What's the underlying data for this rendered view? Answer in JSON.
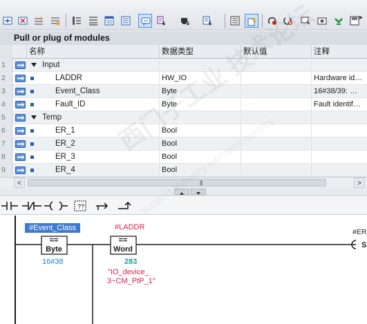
{
  "toolbar": {
    "buttons": [
      {
        "name": "insert-network-icon"
      },
      {
        "name": "delete-network-icon"
      },
      {
        "name": "insert-row-icon"
      },
      {
        "name": "append-row-icon"
      },
      {
        "name": "list-icon"
      },
      {
        "name": "block-view-icon"
      },
      {
        "name": "window-icon"
      },
      {
        "name": "comment-icon"
      },
      {
        "name": "open-branch-icon"
      },
      {
        "name": "monitor-icon"
      },
      {
        "name": "download-icon"
      },
      {
        "name": "absolute-icon"
      },
      {
        "name": "favorites-icon"
      },
      {
        "name": "goto-error-icon"
      },
      {
        "name": "goto-warning-icon"
      },
      {
        "name": "monitor-on-icon"
      },
      {
        "name": "snapshot-icon"
      },
      {
        "name": "load-icon"
      },
      {
        "name": "save-icon"
      }
    ],
    "more_glyph": "▸"
  },
  "panel": {
    "title": "Pull or plug of modules",
    "headers": {
      "name": "名称",
      "type": "数据类型",
      "default": "默认值",
      "comment": "注释"
    },
    "rows": [
      {
        "num": "1",
        "name": "Input",
        "kind": "section",
        "type": "",
        "comment": ""
      },
      {
        "num": "2",
        "name": "LADDR",
        "kind": "var",
        "type": "HW_IO",
        "comment": "Hardware id…"
      },
      {
        "num": "3",
        "name": "Event_Class",
        "kind": "var",
        "type": "Byte",
        "comment": "16#38/39: …"
      },
      {
        "num": "4",
        "name": "Fault_ID",
        "kind": "var",
        "type": "Byte",
        "comment": "Fault identif…"
      },
      {
        "num": "5",
        "name": "Temp",
        "kind": "section",
        "type": "",
        "comment": ""
      },
      {
        "num": "6",
        "name": "ER_1",
        "kind": "var",
        "type": "Bool",
        "comment": ""
      },
      {
        "num": "7",
        "name": "ER_2",
        "kind": "var",
        "type": "Bool",
        "comment": ""
      },
      {
        "num": "8",
        "name": "ER_3",
        "kind": "var",
        "type": "Bool",
        "comment": ""
      },
      {
        "num": "9",
        "name": "ER_4",
        "kind": "var",
        "type": "Bool",
        "comment": ""
      }
    ],
    "scroll": {
      "left": "<",
      "right": ">",
      "grip": "|||"
    }
  },
  "ladbar": {
    "items": [
      "no-contact-icon",
      "nc-contact-icon",
      "coil-icon",
      "empty-box-icon",
      "open-branch-icon",
      "close-branch-icon"
    ]
  },
  "network": {
    "cmp1": {
      "operand": "#Event_Class",
      "op": "==",
      "type": "Byte",
      "const": "16#38"
    },
    "cmp2": {
      "operand": "#LADDR",
      "op": "==",
      "type": "Word",
      "const": "283",
      "name_line1": "\"IO_device_",
      "name_line2": "3~CM_PtP_1\""
    },
    "coil": {
      "operand": "#ER",
      "kind": "S"
    }
  },
  "watermark": {
    "line1": "西门子工业  技术论坛",
    "line2": "support.industry.siemens.com/cs"
  },
  "colors": {
    "accent": "#3e7bd0",
    "operand_red": "#d7204c",
    "const_blue": "#1a7fc9",
    "const_teal": "#1f9a9a"
  }
}
